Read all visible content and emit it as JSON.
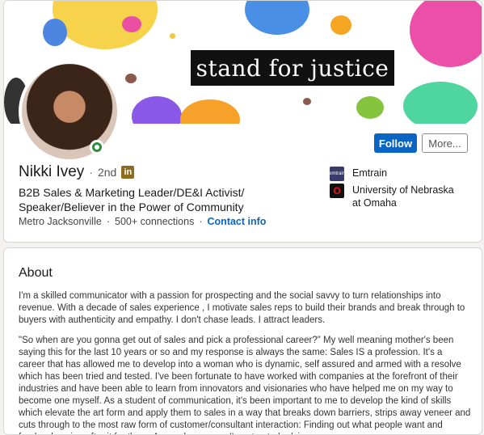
{
  "banner": {
    "text": "stand for justice"
  },
  "profile": {
    "name": "Nikki Ivey",
    "separator": "·",
    "degree": "2nd",
    "headline": "B2B Sales & Marketing Leader/DE&I Activist/ Speaker/Believer in the Power of Community",
    "location": "Metro Jacksonville",
    "connections": "500+ connections",
    "contact": "Contact info"
  },
  "actions": {
    "follow": "Follow",
    "more": "More..."
  },
  "orgs": [
    {
      "name": "Emtrain",
      "logo_text": "emtrain",
      "logo_color": "#3b3b6b"
    },
    {
      "name": "University of Nebraska at Omaha",
      "logo_text": "O",
      "logo_color": "#111111"
    }
  ],
  "about": {
    "title": "About",
    "paragraphs": [
      "I'm a skilled communicator with a passion for prospecting and the social savvy to turn relationships into revenue. With a decade of sales experience , I motivate sales reps to build their brands and break through to buyers with authenticity and empathy. I don't chase leads. I attract leaders.",
      "\"So when are you gonna get out of sales and pick a professional career?\" My well meaning mother's been saying this for the last 10 years or so and my response is always the same: Sales IS a profession. It's a career that has allowed me to develop into a woman who is dynamic, self assured and armed with a resolve which has been tried and tested. I've been fortunate to have worked with companies at the forefront of their industries and have been able to learn from innovators and visionaries who have helped me on my way to become one myself. As a student of communication, it's been important to me to develop the kind of skills which elevate the art form and apply them to sales in a way that breaks down barriers, strips away veneer and cuts through to the most raw form of customer/consultant interaction: Finding out what people want and fearlessly going after it for them. As a salesperson, I'm a trusted adviser, an"
    ]
  },
  "colors": {
    "accent": "#0a66c2",
    "online": "#2e8b3f",
    "linkedin_badge": "#8c6d1f"
  }
}
